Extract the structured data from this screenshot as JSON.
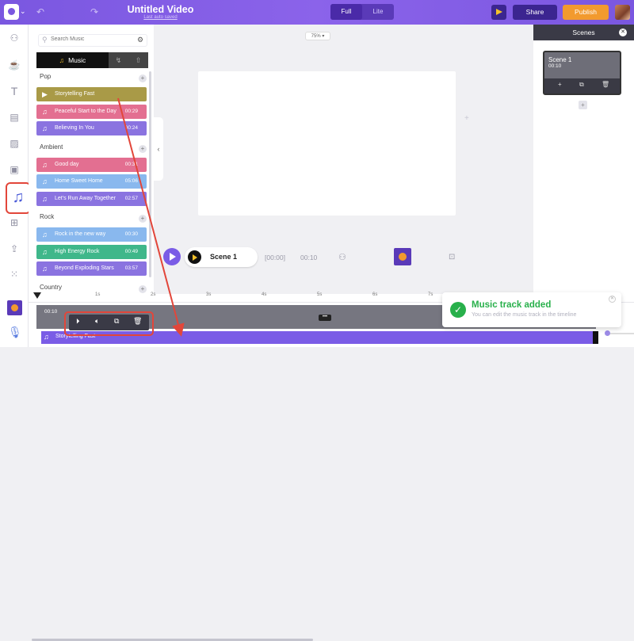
{
  "topbar": {
    "title": "Untitled Video",
    "subtitle": "Last auto saved",
    "mode_full": "Full",
    "mode_lite": "Lite",
    "share_label": "Share",
    "publish_label": "Publish",
    "colors": {
      "accent": "#7a57e0",
      "publish": "#f29a2e",
      "preview": "#f3c12b"
    }
  },
  "leftnav": {
    "icons": [
      "character-icon",
      "props-icon",
      "text-icon",
      "background-icon",
      "image-icon",
      "video-icon",
      "music-icon",
      "templates-icon",
      "upload-icon",
      "more-apps-icon"
    ]
  },
  "music_panel": {
    "search_placeholder": "Search Music",
    "tab_music": "Music",
    "categories": [
      {
        "name": "Pop",
        "tracks": [
          {
            "name": "Storytelling Fast",
            "duration": "",
            "color": "#a99a47",
            "playing": true
          },
          {
            "name": "Peaceful Start to the Day",
            "duration": "00:29",
            "color": "#e36f91"
          },
          {
            "name": "Believing In You",
            "duration": "00:24",
            "color": "#8a73e0"
          }
        ]
      },
      {
        "name": "Ambient",
        "tracks": [
          {
            "name": "Good day",
            "duration": "00:31",
            "color": "#e36f91"
          },
          {
            "name": "Home Sweet Home",
            "duration": "05:06",
            "color": "#89b8ee"
          },
          {
            "name": "Let's Run Away Together",
            "duration": "02:57",
            "color": "#8a73e0"
          }
        ]
      },
      {
        "name": "Rock",
        "tracks": [
          {
            "name": "Rock in the new way",
            "duration": "00:30",
            "color": "#89b8ee"
          },
          {
            "name": "High Energy Rock",
            "duration": "00:49",
            "color": "#3fb78a"
          },
          {
            "name": "Beyond Exploding Stars",
            "duration": "03:57",
            "color": "#8a73e0"
          }
        ]
      },
      {
        "name": "Country",
        "tracks": []
      }
    ]
  },
  "canvas": {
    "zoom": "75%",
    "scene_label": "Scene 1",
    "time_start": "[00:00]",
    "time_duration": "00:10"
  },
  "scenes_panel": {
    "header": "Scenes",
    "card_title": "Scene 1",
    "card_time": "00:10"
  },
  "timeline": {
    "ticks": [
      "1s",
      "2s",
      "3s",
      "4s",
      "5s",
      "6s",
      "7s"
    ],
    "scene_track_label": "00:10",
    "music_track_label": "Storytelling Fast",
    "controls": [
      "play-icon",
      "volume-icon",
      "duplicate-icon",
      "delete-icon"
    ]
  },
  "toast": {
    "title": "Music track added",
    "body": "You can edit the music track in the timeline"
  }
}
